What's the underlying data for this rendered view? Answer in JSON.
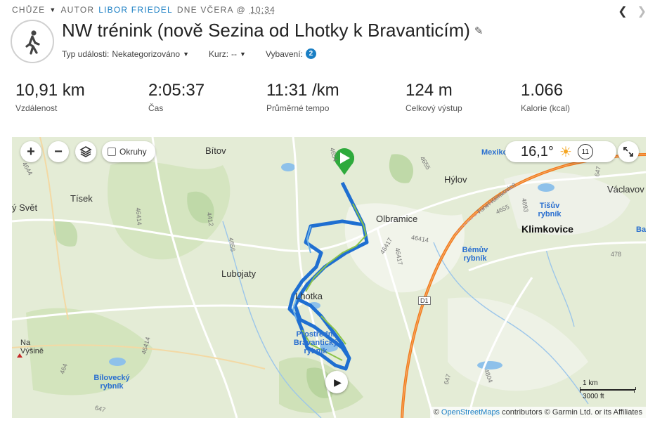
{
  "header": {
    "activity_type": "CHŮZE",
    "author_prefix": "AUTOR",
    "author_name": "LIBOR FRIEDEL",
    "date_prefix": "DNE VČERA @",
    "time": "10:34",
    "title": "NW trénink (nově Sezina od Lhotky k Bravanticím)",
    "event_type_label": "Typ události:",
    "event_type_value": "Nekategorizováno",
    "course_label": "Kurz:",
    "course_value": "--",
    "gear_label": "Vybavení:",
    "gear_count": "2"
  },
  "stats": [
    {
      "value": "10,91 km",
      "label": "Vzdálenost"
    },
    {
      "value": "2:05:37",
      "label": "Čas"
    },
    {
      "value": "11:31 /km",
      "label": "Průměrné tempo"
    },
    {
      "value": "124 m",
      "label": "Celkový výstup"
    },
    {
      "value": "1.066",
      "label": "Kalorie (kcal)"
    }
  ],
  "map": {
    "okruhy_label": "Okruhy",
    "temperature": "16,1°",
    "wind_speed": "11",
    "scale_km": "1 km",
    "scale_ft": "3000 ft",
    "attribution_prefix": "©",
    "attribution_link": "OpenStreetMaps",
    "attribution_rest": "contributors © Garmin Ltd. or its Affiliates",
    "places": {
      "bitov": "Bítov",
      "tisek": "Tísek",
      "svet": "ý Svět",
      "olbramice": "Olbramice",
      "lubojaty": "Lubojaty",
      "lhotka": "Lhotka",
      "hylov": "Hýlov",
      "klimkovice": "Klimkovice",
      "vaclavov": "Václavov",
      "mexiko": "Mexiko",
      "na_vysine": "Na Výšině",
      "tisuv": "Tišův rybník",
      "bemuv": "Bémův rybník",
      "bilovecky": "Bílovecký rybník",
      "prostredni": "Prostřední Bravantický rybník",
      "ba": "Ba",
      "tunel": "Tunel Klimkovice",
      "d1": "D1"
    },
    "roads": [
      "4654",
      "4655",
      "4693",
      "4412",
      "4656",
      "46414",
      "4655",
      "46417",
      "46417",
      "46414",
      "4804",
      "647",
      "647",
      "478",
      "464",
      "4644",
      "647",
      "46414"
    ]
  },
  "colors": {
    "accent": "#1b7fc4",
    "route_blue": "#1f6fd1",
    "route_green": "#8bc34a",
    "highway_orange": "#f07b1a",
    "start_green": "#2eaa3c"
  }
}
